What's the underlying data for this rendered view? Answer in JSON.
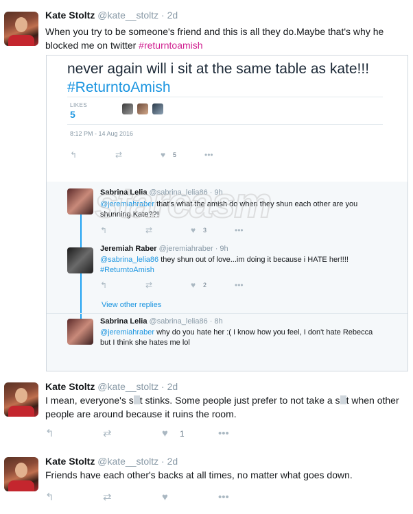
{
  "tweets": [
    {
      "name": "Kate Stoltz",
      "handle": "@kate__stoltz",
      "sep": "·",
      "time": "2d",
      "text": "When you try to be someone's friend and this is all they do.Maybe that's why he blocked me on twitter ",
      "hashtag": "#returntoamish"
    },
    {
      "name": "Kate Stoltz",
      "handle": "@kate__stoltz",
      "sep": "·",
      "time": "2d",
      "text_a": "I mean, everyone's s",
      "text_b": "t stinks. Some people just prefer to not take a s",
      "text_c": "t when other people are around because it ruins the room.",
      "likes": "1"
    },
    {
      "name": "Kate Stoltz",
      "handle": "@kate__stoltz",
      "sep": "·",
      "time": "2d",
      "text": "Friends have each other's backs at all times, no matter what goes down."
    }
  ],
  "embed": {
    "tweet_text": "never again will i sit at the same table as kate!!!",
    "hashtag": "#ReturntoAmish",
    "likes_label": "LIKES",
    "likes_count": "5",
    "timestamp": "8:12 PM - 14 Aug 2016",
    "like_count_action": "5",
    "watermark": "starcasm",
    "replies": [
      {
        "name": "Sabrina Lelia",
        "handle": "@sabrina_lelia86 · 9h",
        "mention": "@jeremiahraber",
        "text": " that's what the amish do when they shun each other are you shunning Kate??!",
        "likes": "3"
      },
      {
        "name": "Jeremiah Raber",
        "handle": "@jeremiahraber · 9h",
        "mention": "@sabrina_lelia86",
        "text": " they shun out of love...im doing it because i HATE her!!!!",
        "hashtag": "#ReturntoAmish",
        "likes": "2"
      },
      {
        "name": "Sabrina Lelia",
        "handle": "@sabrina_lelia86 · 8h",
        "mention": "@jeremiahraber",
        "text": " why do you hate her :( I know how you feel,  I don't hate Rebecca but I think she hates me lol"
      }
    ],
    "view_other_replies": "View other replies"
  },
  "icons": {
    "reply": "↰",
    "retweet": "⇄",
    "like": "♥",
    "more": "•••"
  },
  "colors": {
    "hashtag_pink": "#d02090",
    "twitter_blue": "#1b95e0",
    "icon_gray": "#aab8c2"
  }
}
